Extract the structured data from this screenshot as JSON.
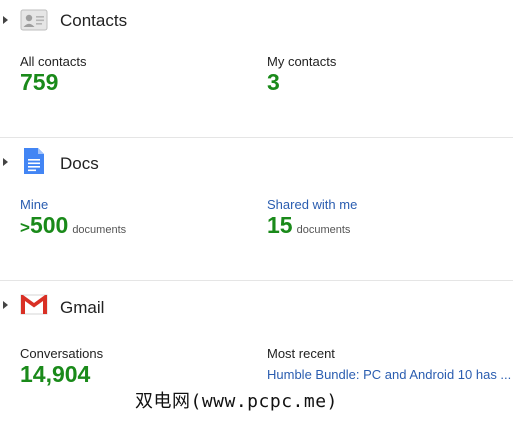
{
  "contacts": {
    "title": "Contacts",
    "all_label": "All contacts",
    "all_value": "759",
    "my_label": "My contacts",
    "my_value": "3"
  },
  "docs": {
    "title": "Docs",
    "mine_label": "Mine",
    "mine_prefix": ">",
    "mine_value": "500",
    "mine_unit": "documents",
    "shared_label": "Shared with me",
    "shared_value": "15",
    "shared_unit": "documents"
  },
  "gmail": {
    "title": "Gmail",
    "conversations_label": "Conversations",
    "conversations_value": "14,904",
    "recent_label": "Most recent",
    "recent_value": "Humble Bundle: PC and Android 10 has ..."
  },
  "watermark": "双电网(www.pcpc.me)",
  "colors": {
    "count_green": "#1a8a1a",
    "link_blue": "#2a5db0",
    "gmail_red": "#d93025",
    "docs_blue": "#4285f4"
  }
}
